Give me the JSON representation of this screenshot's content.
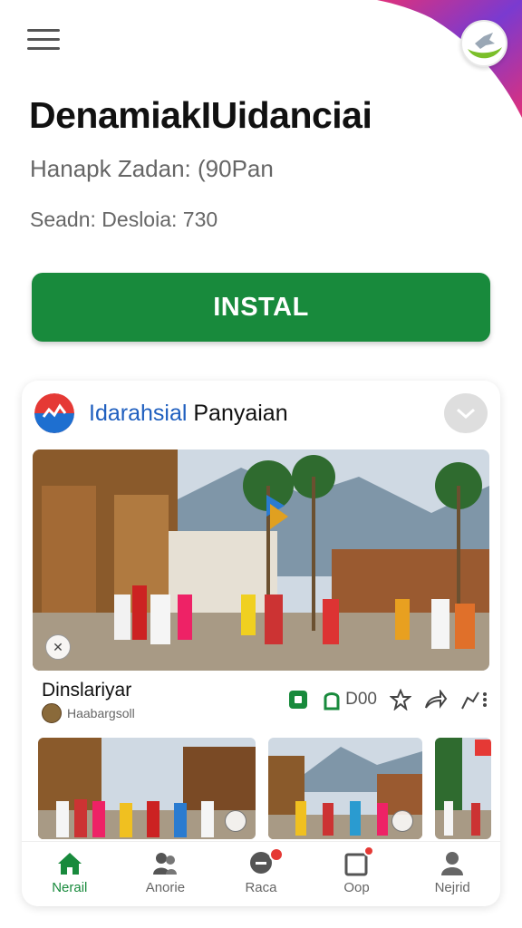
{
  "header": {
    "menu_icon": "hamburger-icon",
    "logo_icon": "bird-logo-icon"
  },
  "app": {
    "title": "DenamiakIUidanciai",
    "subtitle": "Hanapk Zadan: (90Pan",
    "meta": "Seadn: Desloia: 730",
    "install_label": "INSTAL",
    "install_color": "#188a3c"
  },
  "card": {
    "title_blue": "Idarahsial",
    "title_dark": "Panyaian",
    "check_icon": "check-icon",
    "post_title": "Dinslariyar",
    "post_author": "Haabargsoll",
    "actions": {
      "bookmark_icon": "bookmark-icon",
      "like_icon": "thumb-icon",
      "like_count": "D00",
      "star_icon": "star-icon",
      "share_icon": "share-icon",
      "more_icon": "more-icon"
    }
  },
  "nav": {
    "items": [
      {
        "label": "Nerail",
        "icon": "home-icon",
        "active": true
      },
      {
        "label": "Anorie",
        "icon": "people-icon",
        "active": false
      },
      {
        "label": "Raca",
        "icon": "chat-icon",
        "active": false,
        "badge": true
      },
      {
        "label": "Oop",
        "icon": "inbox-icon",
        "active": false,
        "badge": true
      },
      {
        "label": "Nejrid",
        "icon": "person-icon",
        "active": false
      }
    ],
    "active_color": "#188a3c",
    "badge_color": "#e53935"
  }
}
